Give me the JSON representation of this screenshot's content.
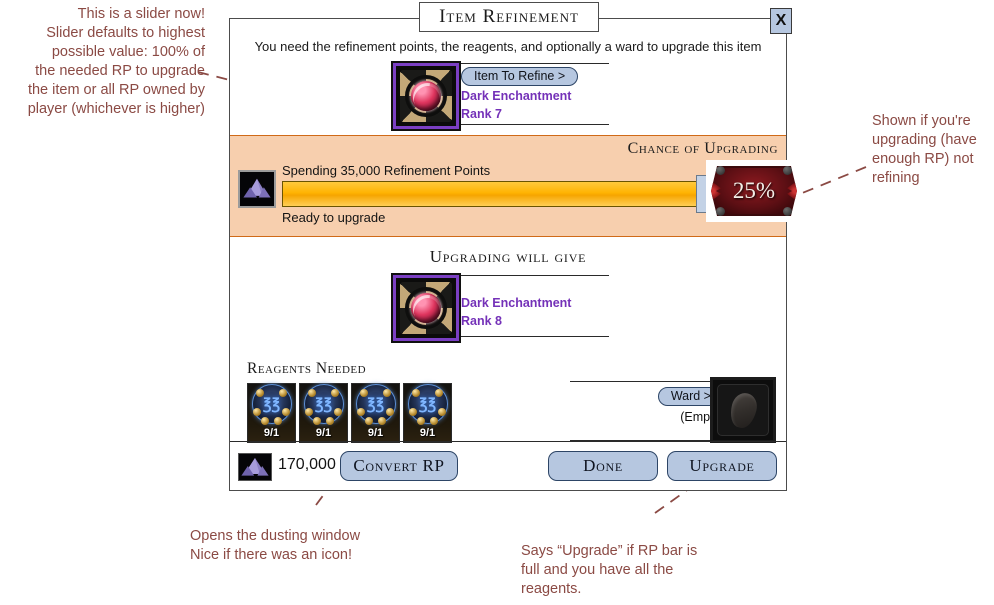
{
  "dialog": {
    "title": "Item Refinement",
    "close_label": "X",
    "subtitle": "You need the refinement points, the reagents, and optionally a ward to upgrade this item",
    "item_to_refine": {
      "button_label": "Item To Refine >",
      "name": "Dark Enchantment",
      "rank": "Rank 7",
      "icon": "dark-enchantment-icon"
    },
    "rp_panel": {
      "coin_icon": "refinement-point-crystal-icon",
      "spending_label": "Spending 35,000 Refinement Points",
      "status_label": "Ready to upgrade",
      "slider_value_percent": 100,
      "chance_title": "Chance of Upgrading",
      "chance_value": "25%",
      "panel_color": "#f7cfae",
      "bar_color": "#ffb302"
    },
    "upgrade_result": {
      "heading": "Upgrading will give",
      "name": "Dark Enchantment",
      "rank": "Rank 8",
      "icon": "dark-enchantment-icon"
    },
    "reagents": {
      "heading": "Reagents Needed",
      "items": [
        {
          "icon": "reagent-orb-icon",
          "count": "9/1"
        },
        {
          "icon": "reagent-orb-icon",
          "count": "9/1"
        },
        {
          "icon": "reagent-orb-icon",
          "count": "9/1"
        },
        {
          "icon": "reagent-orb-icon",
          "count": "9/1"
        }
      ]
    },
    "ward": {
      "button_label": "Ward >",
      "empty_label": "(Empty)",
      "slot_icon": "ward-stone-icon"
    },
    "footer": {
      "coin_icon": "refinement-point-crystal-icon",
      "amount": "170,000",
      "convert_label": "Convert RP",
      "done_label": "Done",
      "upgrade_label": "Upgrade"
    }
  },
  "annotations": {
    "slider_note": "This is a slider now!\nSlider defaults to highest\npossible value: 100% of\nthe needed RP to upgrade\nthe item or all RP owned by\nplayer (whichever is higher)",
    "chance_note": "Shown if you're\nupgrading (have\nenough RP) not\nrefining",
    "convert_note": "Opens the dusting window\nNice if there was an icon!",
    "upgrade_note": "Says “Upgrade” if RP bar is\nfull and you have all the\nreagents.",
    "color": "#8b4a44"
  }
}
